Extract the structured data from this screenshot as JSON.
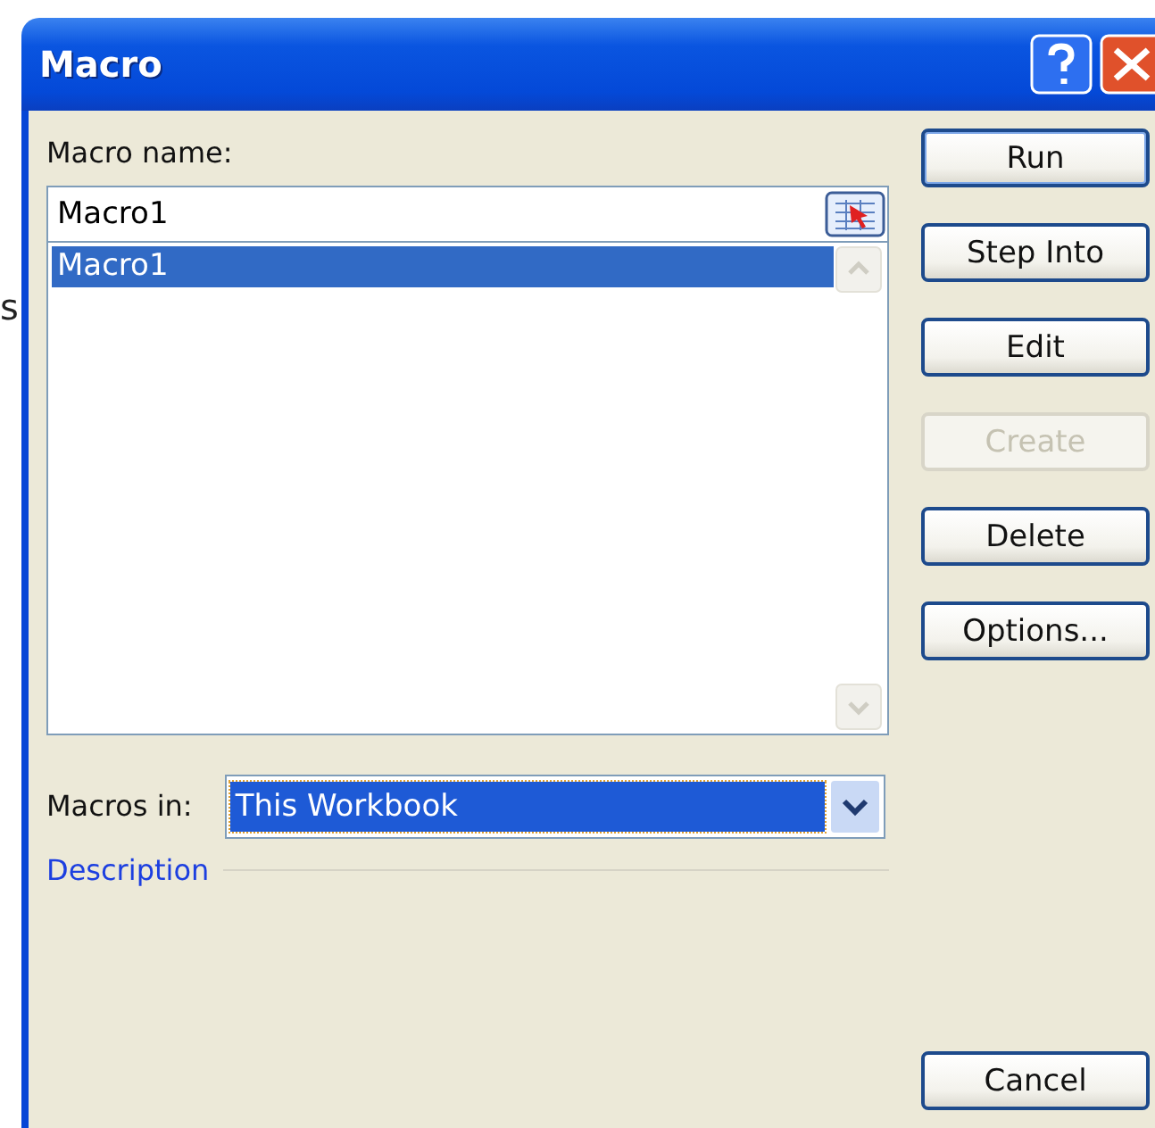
{
  "background_text": "s",
  "window": {
    "title": "Macro"
  },
  "macro_name": {
    "label": "Macro name:",
    "value": "Macro1"
  },
  "macro_list": {
    "items": [
      {
        "label": "Macro1",
        "selected": true
      }
    ]
  },
  "buttons": [
    {
      "label": "Run",
      "default": true,
      "disabled": false
    },
    {
      "label": "Step Into",
      "default": false,
      "disabled": false
    },
    {
      "label": "Edit",
      "default": false,
      "disabled": false
    },
    {
      "label": "Create",
      "default": false,
      "disabled": true
    },
    {
      "label": "Delete",
      "default": false,
      "disabled": false
    },
    {
      "label": "Options...",
      "default": false,
      "disabled": false
    }
  ],
  "macros_in": {
    "label": "Macros in:",
    "value": "This Workbook"
  },
  "description": {
    "label": "Description"
  },
  "cancel_button": {
    "label": "Cancel"
  }
}
